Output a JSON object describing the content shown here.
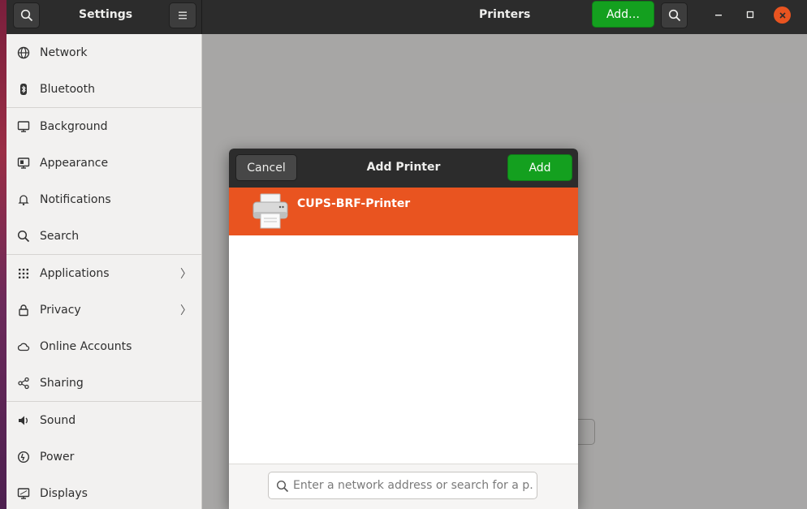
{
  "window": {
    "sidebar_title": "Settings",
    "page_title": "Printers",
    "add_button_label": "Add…"
  },
  "sidebar": {
    "items": [
      {
        "label": "Network",
        "icon": "network-icon"
      },
      {
        "label": "Bluetooth",
        "icon": "bluetooth-icon"
      },
      {
        "label": "Background",
        "icon": "background-icon"
      },
      {
        "label": "Appearance",
        "icon": "appearance-icon"
      },
      {
        "label": "Notifications",
        "icon": "bell-icon"
      },
      {
        "label": "Search",
        "icon": "search-icon"
      },
      {
        "label": "Applications",
        "icon": "grid-icon",
        "chevron": "〉"
      },
      {
        "label": "Privacy",
        "icon": "lock-icon",
        "chevron": "〉"
      },
      {
        "label": "Online Accounts",
        "icon": "cloud-icon"
      },
      {
        "label": "Sharing",
        "icon": "share-icon"
      },
      {
        "label": "Sound",
        "icon": "speaker-icon"
      },
      {
        "label": "Power",
        "icon": "power-icon"
      },
      {
        "label": "Displays",
        "icon": "display-icon"
      }
    ]
  },
  "dialog": {
    "title": "Add Printer",
    "cancel_label": "Cancel",
    "add_label": "Add",
    "printers": [
      {
        "name": "CUPS-BRF-Printer",
        "selected": true
      }
    ],
    "search_placeholder": "Enter a network address or search for a p…"
  },
  "colors": {
    "accent_orange": "#e95420",
    "suggested_green": "#14a01f",
    "headerbar": "#2c2c2c"
  }
}
